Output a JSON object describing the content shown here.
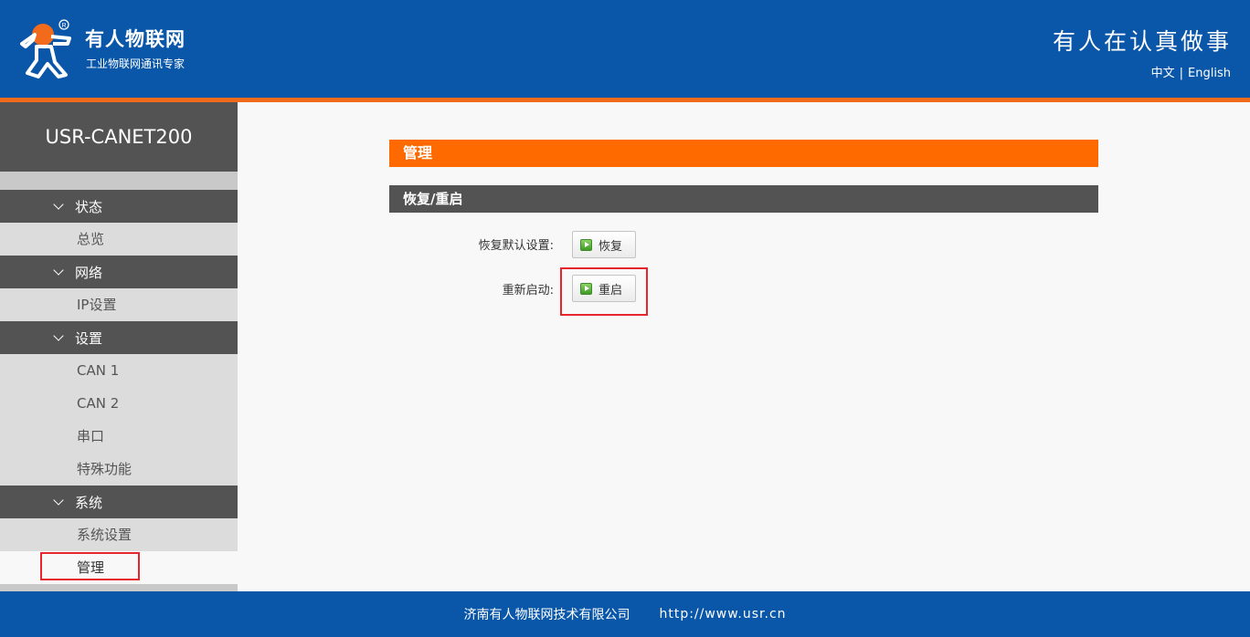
{
  "header": {
    "brand_name": "有人物联网",
    "brand_sub": "工业物联网通讯专家",
    "slogan": "有人在认真做事",
    "lang_zh": "中文",
    "lang_sep": "|",
    "lang_en": "English",
    "logo_icon": "usr-logo-icon",
    "colors": {
      "header_bg": "#0a57a9",
      "stripe": "#f26b1d"
    }
  },
  "sidebar": {
    "device_name": "USR-CANET200",
    "groups": [
      {
        "label": "状态",
        "items": [
          "总览"
        ]
      },
      {
        "label": "网络",
        "items": [
          "IP设置"
        ]
      },
      {
        "label": "设置",
        "items": [
          "CAN 1",
          "CAN 2",
          "串口",
          "特殊功能"
        ]
      },
      {
        "label": "系统",
        "items": [
          "系统设置",
          "管理"
        ]
      }
    ],
    "active_item": "管理"
  },
  "main": {
    "section_title": "管理",
    "subsection_title": "恢复/重启",
    "rows": [
      {
        "label": "恢复默认设置:",
        "button": "恢复"
      },
      {
        "label": "重新启动:",
        "button": "重启"
      }
    ],
    "colors": {
      "accent": "#fe6a00",
      "dark_bar": "#535353",
      "highlight": "#e8242c"
    }
  },
  "footer": {
    "company": "济南有人物联网技术有限公司",
    "url": "http://www.usr.cn"
  }
}
